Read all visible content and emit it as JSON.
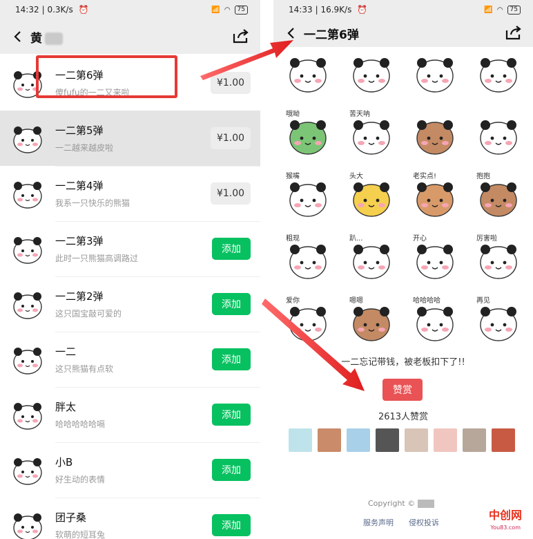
{
  "left": {
    "status": {
      "time": "14:32",
      "speed": "0.3K/s",
      "battery": "75"
    },
    "title": "黄",
    "items": [
      {
        "title": "一二第6弹",
        "subtitle": "傻fufu的一二又来啦",
        "action": "¥1.00",
        "type": "price"
      },
      {
        "title": "一二第5弹",
        "subtitle": "一二越来越皮啦",
        "action": "¥1.00",
        "type": "price"
      },
      {
        "title": "一二第4弹",
        "subtitle": "我系一只快乐的熊猫",
        "action": "¥1.00",
        "type": "price"
      },
      {
        "title": "一二第3弹",
        "subtitle": "此时一只熊猫高调路过",
        "action": "添加",
        "type": "add"
      },
      {
        "title": "一二第2弹",
        "subtitle": "这只国宝敲可爱的",
        "action": "添加",
        "type": "add"
      },
      {
        "title": "一二",
        "subtitle": "这只熊猫有点软",
        "action": "添加",
        "type": "add"
      },
      {
        "title": "胖太",
        "subtitle": "哈哈哈哈哈嗝",
        "action": "添加",
        "type": "add"
      },
      {
        "title": "小B",
        "subtitle": "好生动的表情",
        "action": "添加",
        "type": "add"
      },
      {
        "title": "团子桑",
        "subtitle": "软萌的短耳兔",
        "action": "添加",
        "type": "add"
      }
    ]
  },
  "right": {
    "status": {
      "time": "14:33",
      "speed": "16.9K/s",
      "battery": "75"
    },
    "title": "一二第6弹",
    "captions": [
      "哦呦",
      "苦天呐",
      "猴嘴",
      "头大",
      "老实点!",
      "抱抱",
      "粗现",
      "趴...",
      "开心",
      "厉害啦",
      "爱你",
      "嗯嗯",
      "哈哈哈哈",
      "再见"
    ],
    "message": "一二忘记带钱，被老板扣下了!!",
    "reward_button": "赞赏",
    "reward_count": "2613人赞赏",
    "copyright": "Copyright ©",
    "links": [
      "服务声明",
      "侵权投诉"
    ]
  },
  "watermark": {
    "text": "中创网",
    "url": "You83.com"
  },
  "colors": {
    "green": "#07c160",
    "red": "#e53935",
    "reward": "#e95355"
  }
}
